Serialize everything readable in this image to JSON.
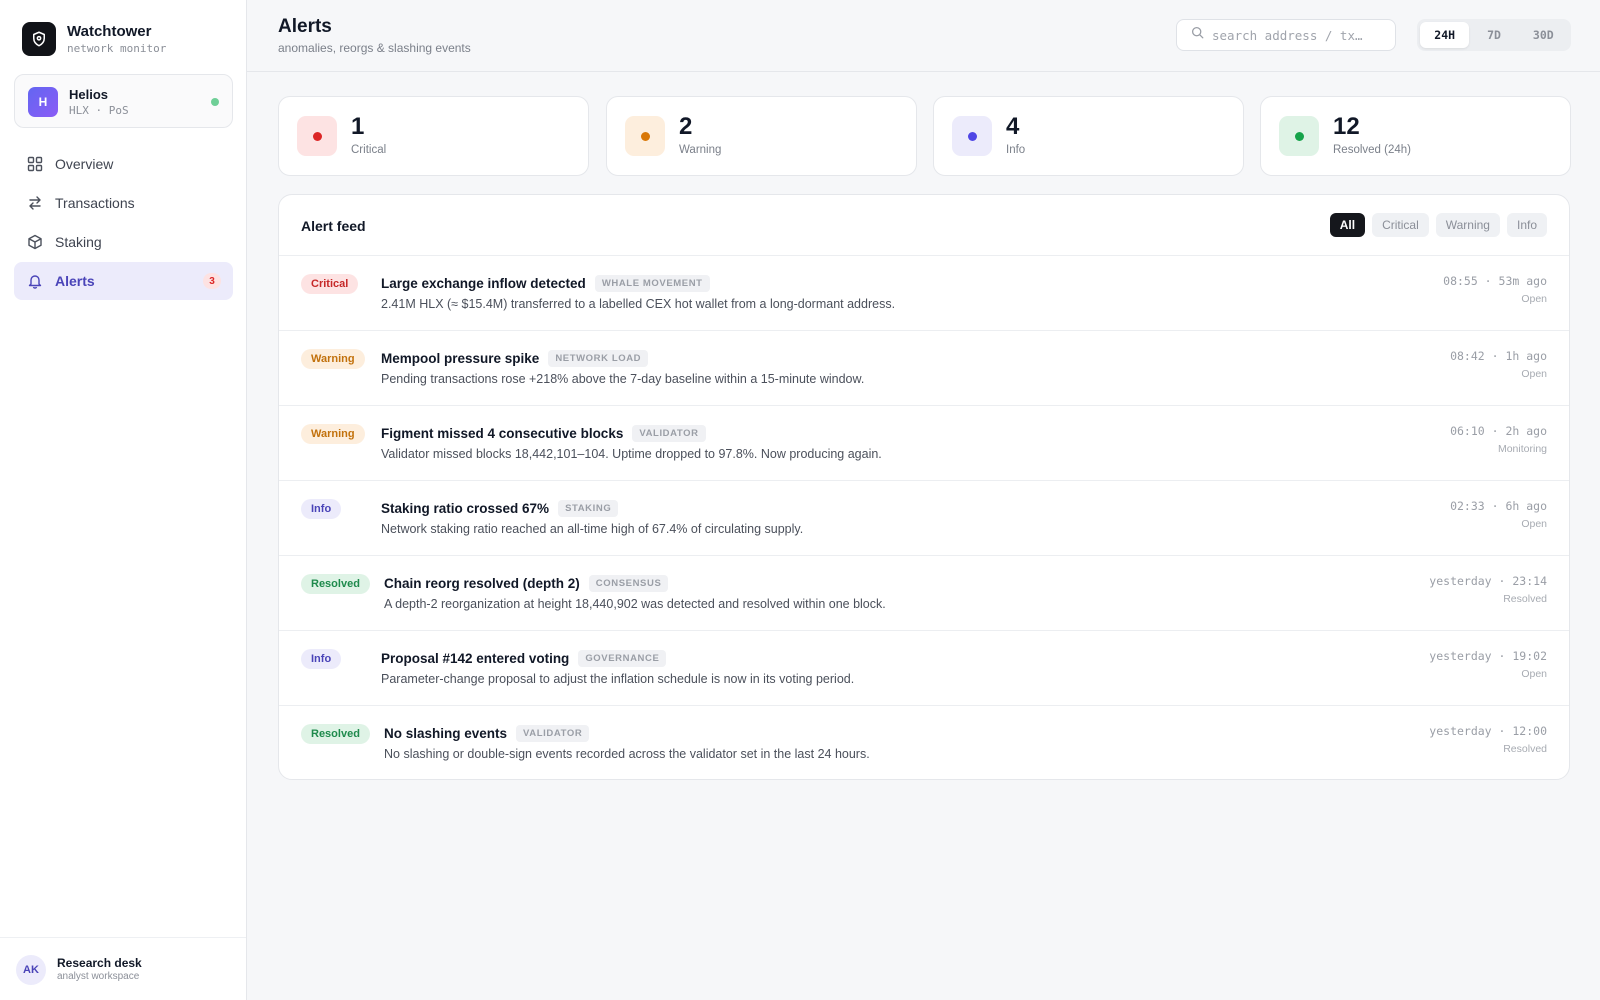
{
  "brand": {
    "name": "Watchtower",
    "subtitle": "network monitor"
  },
  "network": {
    "avatar": "H",
    "name": "Helios",
    "sub": "HLX · PoS",
    "status_color": "#6fcf97"
  },
  "nav": [
    {
      "label": "Overview",
      "icon": "grid-icon",
      "active": false
    },
    {
      "label": "Transactions",
      "icon": "arrows-swap-icon",
      "active": false
    },
    {
      "label": "Staking",
      "icon": "cube-icon",
      "active": false
    },
    {
      "label": "Alerts",
      "icon": "bell-icon",
      "active": true,
      "badge": "3"
    }
  ],
  "user": {
    "initials": "AK",
    "name": "Research desk",
    "sub": "analyst workspace"
  },
  "header": {
    "title": "Alerts",
    "subtitle": "anomalies, reorgs & slashing events",
    "search_placeholder": "search address / tx…",
    "ranges": [
      "24H",
      "7D",
      "30D"
    ],
    "active_range": "24H"
  },
  "stats": [
    {
      "value": "1",
      "label": "Critical",
      "color": "#dc2626",
      "bg": "#fde3e3"
    },
    {
      "value": "2",
      "label": "Warning",
      "color": "#d97706",
      "bg": "#fdeedd"
    },
    {
      "value": "4",
      "label": "Info",
      "color": "#4f46e5",
      "bg": "#ecebfb"
    },
    {
      "value": "12",
      "label": "Resolved (24h)",
      "color": "#16a34a",
      "bg": "#dff3e6"
    }
  ],
  "feed": {
    "title": "Alert feed",
    "filters": [
      "All",
      "Critical",
      "Warning",
      "Info"
    ],
    "active_filter": "All",
    "alerts": [
      {
        "severity": "Critical",
        "title": "Large exchange inflow detected",
        "tag": "WHALE MOVEMENT",
        "desc": "2.41M HLX (≈ $15.4M) transferred to a labelled CEX hot wallet from a long-dormant address.",
        "time": "08:55 · 53m ago",
        "status": "Open"
      },
      {
        "severity": "Warning",
        "title": "Mempool pressure spike",
        "tag": "NETWORK LOAD",
        "desc": "Pending transactions rose +218% above the 7-day baseline within a 15-minute window.",
        "time": "08:42 · 1h ago",
        "status": "Open"
      },
      {
        "severity": "Warning",
        "title": "Figment missed 4 consecutive blocks",
        "tag": "VALIDATOR",
        "desc": "Validator missed blocks 18,442,101–104. Uptime dropped to 97.8%. Now producing again.",
        "time": "06:10 · 2h ago",
        "status": "Monitoring"
      },
      {
        "severity": "Info",
        "title": "Staking ratio crossed 67%",
        "tag": "STAKING",
        "desc": "Network staking ratio reached an all-time high of 67.4% of circulating supply.",
        "time": "02:33 · 6h ago",
        "status": "Open"
      },
      {
        "severity": "Resolved",
        "title": "Chain reorg resolved (depth 2)",
        "tag": "CONSENSUS",
        "desc": "A depth-2 reorganization at height 18,440,902 was detected and resolved within one block.",
        "time": "yesterday · 23:14",
        "status": "Resolved"
      },
      {
        "severity": "Info",
        "title": "Proposal #142 entered voting",
        "tag": "GOVERNANCE",
        "desc": "Parameter-change proposal to adjust the inflation schedule is now in its voting period.",
        "time": "yesterday · 19:02",
        "status": "Open"
      },
      {
        "severity": "Resolved",
        "title": "No slashing events",
        "tag": "VALIDATOR",
        "desc": "No slashing or double-sign events recorded across the validator set in the last 24 hours.",
        "time": "yesterday · 12:00",
        "status": "Resolved"
      }
    ]
  }
}
